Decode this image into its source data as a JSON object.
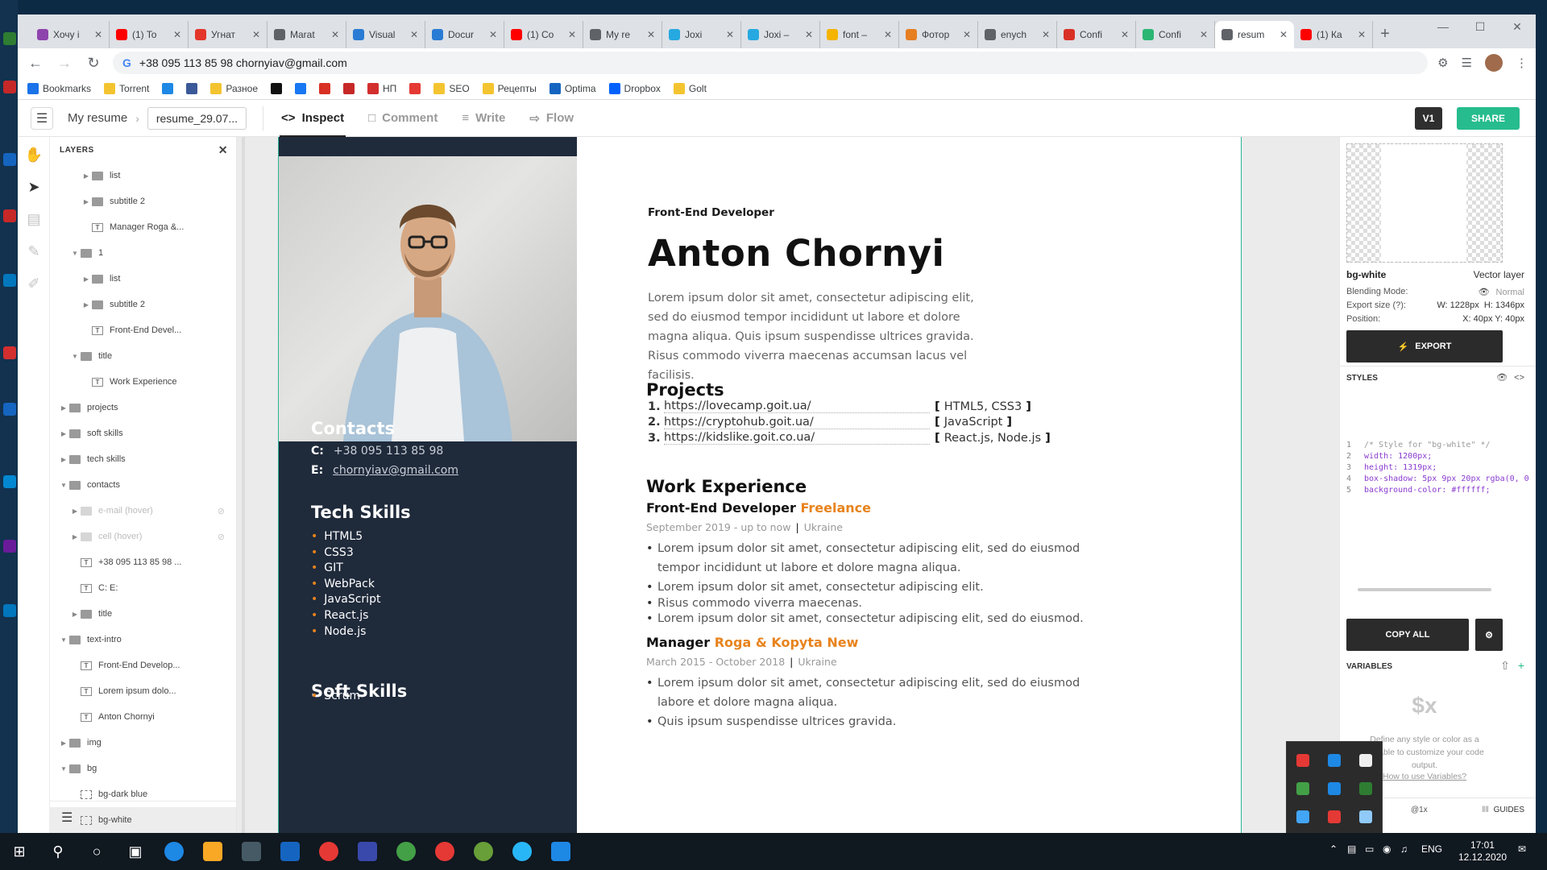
{
  "browser": {
    "tabs": [
      {
        "label": "Хочу і",
        "color": "#8e44ad"
      },
      {
        "label": "(1) To",
        "color": "#ff0000"
      },
      {
        "label": "Угнат",
        "color": "#e4352b"
      },
      {
        "label": "Marat",
        "color": "#5f6368"
      },
      {
        "label": "Visual",
        "color": "#2a7bd4"
      },
      {
        "label": "Docur",
        "color": "#2a7bd4"
      },
      {
        "label": "(1) Co",
        "color": "#ff0000"
      },
      {
        "label": "My re",
        "color": "#5f6368"
      },
      {
        "label": "Joxi",
        "color": "#26a9e0"
      },
      {
        "label": "Joxi –",
        "color": "#26a9e0"
      },
      {
        "label": "font –",
        "color": "#f4b400"
      },
      {
        "label": "Фотор",
        "color": "#e67e22"
      },
      {
        "label": "enych",
        "color": "#5f6368"
      },
      {
        "label": "Confi",
        "color": "#d93025"
      },
      {
        "label": "Confi",
        "color": "#2bb673"
      },
      {
        "label": "resum",
        "color": "#5f6368",
        "active": true
      },
      {
        "label": "(1) Ка",
        "color": "#ff0000"
      }
    ],
    "url": "+38 095 113 85 98 chornyiav@gmail.com",
    "bookmarks": [
      {
        "label": "Bookmarks",
        "color": "#1a73e8"
      },
      {
        "label": "Torrent",
        "color": "#f4c430"
      },
      {
        "label": "",
        "color": "#1e88e5"
      },
      {
        "label": "",
        "color": "#3b5998"
      },
      {
        "label": "Разное",
        "color": "#f4c430"
      },
      {
        "label": "",
        "color": "#111111"
      },
      {
        "label": "",
        "color": "#1877f2"
      },
      {
        "label": "",
        "color": "#d93025"
      },
      {
        "label": "",
        "color": "#c62828"
      },
      {
        "label": "НП",
        "color": "#d32f2f"
      },
      {
        "label": "",
        "color": "#e53935"
      },
      {
        "label": "SEO",
        "color": "#f4c430"
      },
      {
        "label": "Рецепты",
        "color": "#f4c430"
      },
      {
        "label": "Optima",
        "color": "#1565c0"
      },
      {
        "label": "Dropbox",
        "color": "#0061ff"
      },
      {
        "label": "Golt",
        "color": "#f4c430"
      }
    ]
  },
  "app": {
    "project": "My resume",
    "file": "resume_29.07...",
    "modes": [
      {
        "label": "Inspect",
        "icon": "code-icon",
        "active": true
      },
      {
        "label": "Comment",
        "icon": "comment-icon"
      },
      {
        "label": "Write",
        "icon": "lines-icon"
      },
      {
        "label": "Flow",
        "icon": "flow-icon"
      }
    ],
    "version": "V1",
    "share": "SHARE"
  },
  "layers": {
    "title": "LAYERS",
    "items": [
      {
        "label": "list",
        "indent": 2,
        "type": "folder",
        "caret": true
      },
      {
        "label": "subtitle 2",
        "indent": 2,
        "type": "folder",
        "caret": true
      },
      {
        "label": "Manager Roga &...",
        "indent": 2,
        "type": "text"
      },
      {
        "label": "1",
        "indent": 1,
        "type": "folder",
        "caret": true,
        "open": true
      },
      {
        "label": "list",
        "indent": 2,
        "type": "folder",
        "caret": true
      },
      {
        "label": "subtitle 2",
        "indent": 2,
        "type": "folder",
        "caret": true
      },
      {
        "label": "Front-End Devel...",
        "indent": 2,
        "type": "text"
      },
      {
        "label": "title",
        "indent": 1,
        "type": "folder",
        "caret": true,
        "open": true
      },
      {
        "label": "Work Experience",
        "indent": 2,
        "type": "text"
      },
      {
        "label": "projects",
        "indent": 0,
        "type": "folder",
        "caret": true
      },
      {
        "label": "soft skills",
        "indent": 0,
        "type": "folder",
        "caret": true
      },
      {
        "label": "tech skills",
        "indent": 0,
        "type": "folder",
        "caret": true
      },
      {
        "label": "contacts",
        "indent": 0,
        "type": "folder",
        "caret": true,
        "open": true
      },
      {
        "label": "e-mail (hover)",
        "indent": 1,
        "type": "folder",
        "caret": true,
        "dim": true
      },
      {
        "label": "cell (hover)",
        "indent": 1,
        "type": "folder",
        "caret": true,
        "dim": true
      },
      {
        "label": "+38 095 113 85 98 ...",
        "indent": 1,
        "type": "text"
      },
      {
        "label": "C: E:",
        "indent": 1,
        "type": "text"
      },
      {
        "label": "title",
        "indent": 1,
        "type": "folder",
        "caret": true
      },
      {
        "label": "text-intro",
        "indent": 0,
        "type": "folder",
        "caret": true,
        "open": true
      },
      {
        "label": "Front-End Develop...",
        "indent": 1,
        "type": "text"
      },
      {
        "label": "Lorem ipsum dolo...",
        "indent": 1,
        "type": "text"
      },
      {
        "label": "Anton Chornyi",
        "indent": 1,
        "type": "text"
      },
      {
        "label": "img",
        "indent": 0,
        "type": "folder",
        "caret": true
      },
      {
        "label": "bg",
        "indent": 0,
        "type": "folder",
        "caret": true,
        "open": true
      },
      {
        "label": "bg-dark blue",
        "indent": 1,
        "type": "rect"
      },
      {
        "label": "bg-white",
        "indent": 1,
        "type": "rect",
        "selected": true
      }
    ]
  },
  "resume": {
    "contacts_title": "Contacts",
    "phone_label": "C:",
    "phone": "+38 095 113 85 98",
    "email_label": "E:",
    "email": "chornyiav@gmail.com",
    "tech_title": "Tech Skills",
    "tech": [
      "HTML5",
      "CSS3",
      "GIT",
      "WebPack",
      "JavaScript",
      "React.js",
      "Node.js"
    ],
    "soft_title": "Soft Skills",
    "soft": [
      "Scrum"
    ],
    "role": "Front-End Developer",
    "name": "Anton Chornyi",
    "intro": "Lorem ipsum dolor sit amet, consectetur adipiscing elit, sed do eiusmod tempor incididunt ut labore et dolore magna aliqua. Quis ipsum suspendisse ultrices gravida. Risus commodo viverra maecenas accumsan lacus vel facilisis.",
    "projects_title": "Projects",
    "projects": [
      {
        "n": "1.",
        "url": "https://lovecamp.goit.ua/",
        "stack": "HTML5, CSS3"
      },
      {
        "n": "2.",
        "url": "https://cryptohub.goit.ua/",
        "stack": "JavaScript"
      },
      {
        "n": "3.",
        "url": "https://kidslike.goit.co.ua/",
        "stack": "React.js, Node.js"
      }
    ],
    "work_title": "Work Experience",
    "jobs": [
      {
        "title": "Front-End Developer",
        "org": "Freelance",
        "period": "September 2019 - up to now",
        "place": "Ukraine",
        "bullets": [
          "Lorem ipsum dolor sit amet, consectetur adipiscing elit, sed do eiusmod tempor incididunt ut labore et dolore magna aliqua.",
          "Lorem ipsum dolor sit amet, consectetur adipiscing elit.",
          "Risus commodo viverra maecenas.",
          "Lorem ipsum dolor sit amet, consectetur adipiscing elit, sed do eiusmod."
        ]
      },
      {
        "title": "Manager",
        "org": "Roga & Kopyta New",
        "period": "March 2015 - October 2018",
        "place": "Ukraine",
        "bullets": [
          "Lorem ipsum dolor sit amet, consectetur adipiscing elit, sed do eiusmod labore et dolore magna aliqua.",
          "Quis ipsum suspendisse ultrices gravida."
        ]
      }
    ]
  },
  "inspect": {
    "layer_name": "bg-white",
    "layer_type": "Vector layer",
    "blend_label": "Blending Mode:",
    "blend_value": "Normal",
    "export_label": "Export size (?):",
    "export_w": "W:  1228px",
    "export_h": "H:  1346px",
    "position_label": "Position:",
    "position_value": "X: 40px  Y: 40px",
    "export_btn": "EXPORT",
    "styles_title": "STYLES",
    "code": [
      "/* Style for \"bg-white\" */",
      "width: 1200px;",
      "height: 1319px;",
      "box-shadow: 5px 9px 20px rgba(0, 0",
      "background-color: #ffffff;"
    ],
    "copy_all": "COPY ALL",
    "variables_title": "VARIABLES",
    "var_symbol": "$x",
    "var_desc": "Define any style or color as a variable to customize your code output.",
    "var_link": "How to use Variables?",
    "zoom": "@1x",
    "guides": "GUIDES"
  },
  "taskbar": {
    "lang": "ENG",
    "time": "17:01",
    "date": "12.12.2020"
  }
}
